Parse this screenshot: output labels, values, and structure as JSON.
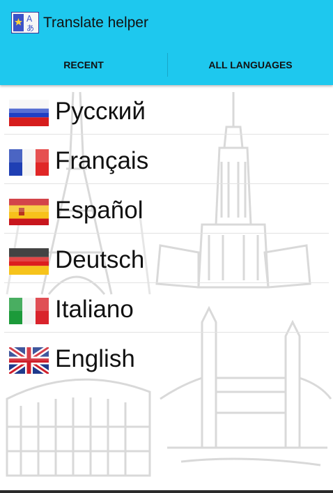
{
  "app": {
    "title": "Translate helper",
    "icon": "translate-icon"
  },
  "tabs": [
    {
      "label": "RECENT",
      "selected": false
    },
    {
      "label": "ALL LANGUAGES",
      "selected": true
    }
  ],
  "languages": [
    {
      "label": "Русский",
      "flag": "russia-flag-icon"
    },
    {
      "label": "Français",
      "flag": "france-flag-icon"
    },
    {
      "label": "Español",
      "flag": "spain-flag-icon"
    },
    {
      "label": "Deutsch",
      "flag": "germany-flag-icon"
    },
    {
      "label": "Italiano",
      "flag": "italy-flag-icon"
    },
    {
      "label": "English",
      "flag": "uk-flag-icon"
    }
  ],
  "colors": {
    "appbar": "#1ec8ee",
    "divider": "#e2e2e2"
  }
}
